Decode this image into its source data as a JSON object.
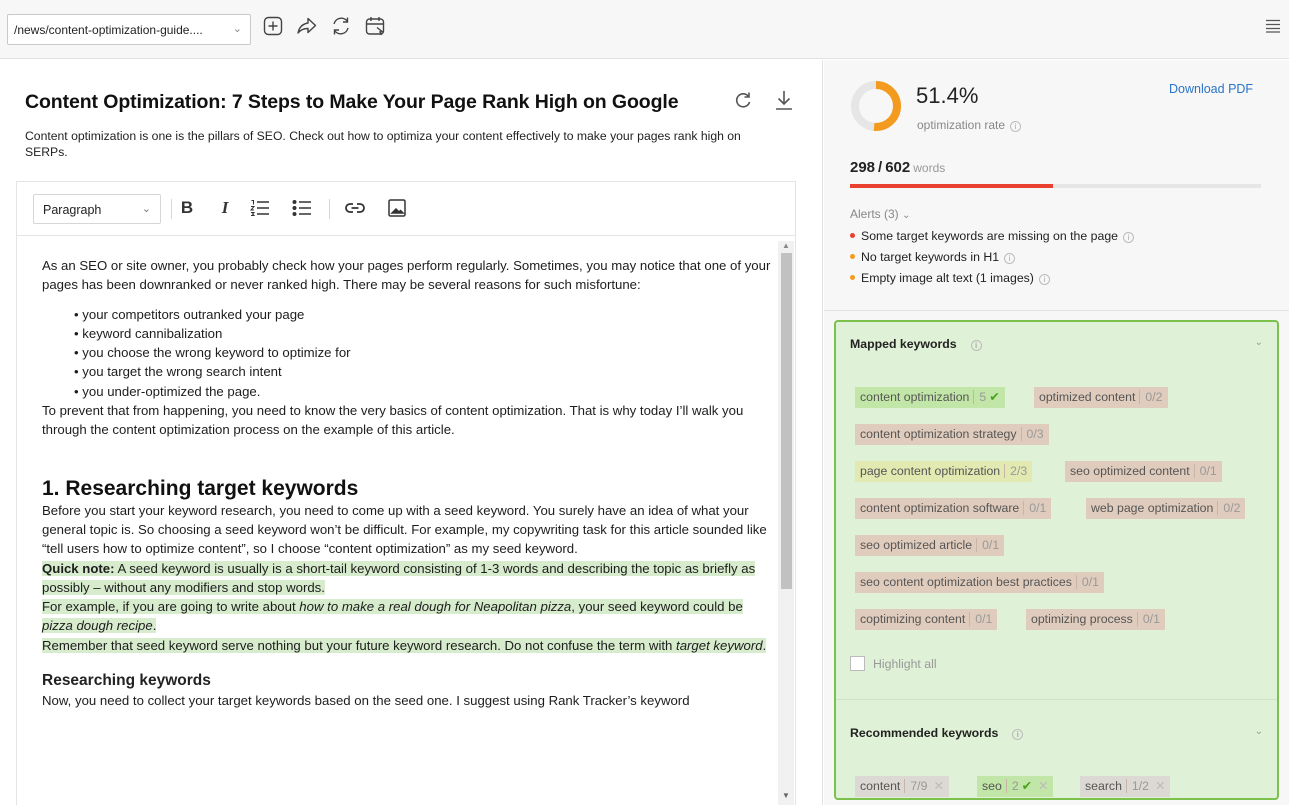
{
  "toolbar": {
    "url": "/news/content-optimization-guide....",
    "icons": [
      "add-page-icon",
      "share-icon",
      "refresh-icon",
      "schedule-icon",
      "menu-icon"
    ]
  },
  "document": {
    "title": "Content Optimization: 7 Steps to Make Your Page Rank High on Google",
    "description": "Content optimization is one is the pillars of SEO. Check out how to optimiza your content effectively to make your pages rank high on SERPs."
  },
  "editor": {
    "block_format": "Paragraph",
    "intro": "As an SEO or site owner, you probably check how your pages perform regularly. Sometimes, you may notice that one of your pages has been downranked or never ranked high. There may be several reasons for such misfortune:",
    "bullets": [
      "your competitors outranked your page",
      "keyword cannibalization",
      "you choose the wrong keyword to optimize for",
      "you target the wrong search intent",
      "you under-optimized the page."
    ],
    "para2": "To prevent that from happening, you need to know the very basics of content optimization. That is why today I’ll walk you through the content optimization process on the example of this article.",
    "h2": "1. Researching target keywords",
    "para3": "Before you start your keyword research, you need to come up with a seed keyword. You surely have an idea of what your general topic is. So choosing a seed keyword won’t be difficult. For example, my copywriting task for this article sounded like “tell users how to optimize content”, so I choose “content optimization” as my seed keyword.",
    "quick_note_label": "Quick note:",
    "quick_note": " A seed keyword is usually is a short-tail keyword consisting of 1-3 words and describing the topic as briefly as possibly – without any modifiers and stop words.",
    "example_a": "For example, if you are going to write about ",
    "example_b": "how to make a real dough for Neapolitan pizza",
    "example_c": ", your seed keyword could be ",
    "example_d": "pizza dough recipe",
    "example_e": ".",
    "remember_a": "Remember that seed keyword serve nothing but your future keyword research. Do not confuse the term with ",
    "remember_b": "target keyword",
    "remember_c": ".",
    "h3": "Researching keywords",
    "para4": "Now, you need to collect your target keywords based on the seed one. I suggest using Rank Tracker’s keyword"
  },
  "stats": {
    "rate": "51.4%",
    "rate_fraction": 0.514,
    "rate_label": "optimization rate",
    "download": "Download PDF",
    "words_current": "298",
    "words_sep": "/",
    "words_total": "602",
    "words_label": "words",
    "words_fraction": 0.495,
    "colors": {
      "rate": "#f39b1f",
      "words_bar": "#e8412f",
      "panel_border": "#7cc04e"
    }
  },
  "alerts": {
    "header": "Alerts (3)",
    "items": [
      {
        "text": "Some target keywords are missing on the page",
        "color": "#e8412f"
      },
      {
        "text": "No target keywords in H1",
        "color": "#f39b1f"
      },
      {
        "text": "Empty image alt text (1 images)",
        "color": "#f39b1f"
      }
    ]
  },
  "mapped": {
    "header": "Mapped keywords",
    "keywords": [
      {
        "text": "content optimization",
        "count": "5",
        "state": "green"
      },
      {
        "text": "optimized content",
        "count": "0/2",
        "state": "brown"
      },
      {
        "text": "content optimization strategy",
        "count": "0/3",
        "state": "brown"
      },
      {
        "text": "page content optimization",
        "count": "2/3",
        "state": "lime"
      },
      {
        "text": "seo optimized content",
        "count": "0/1",
        "state": "brown"
      },
      {
        "text": "content optimization software",
        "count": "0/1",
        "state": "brown"
      },
      {
        "text": "web page optimization",
        "count": "0/2",
        "state": "brown"
      },
      {
        "text": "seo optimized article",
        "count": "0/1",
        "state": "brown"
      },
      {
        "text": "seo content optimization best practices",
        "count": "0/1",
        "state": "brown"
      },
      {
        "text": "coptimizing content",
        "count": "0/1",
        "state": "brown"
      },
      {
        "text": "optimizing process",
        "count": "0/1",
        "state": "brown"
      }
    ],
    "highlight_all": "Highlight all"
  },
  "recommended": {
    "header": "Recommended keywords",
    "keywords": [
      {
        "text": "content",
        "count": "7/9"
      },
      {
        "text": "seo",
        "count": "2"
      },
      {
        "text": "search",
        "count": "1/2"
      }
    ]
  }
}
